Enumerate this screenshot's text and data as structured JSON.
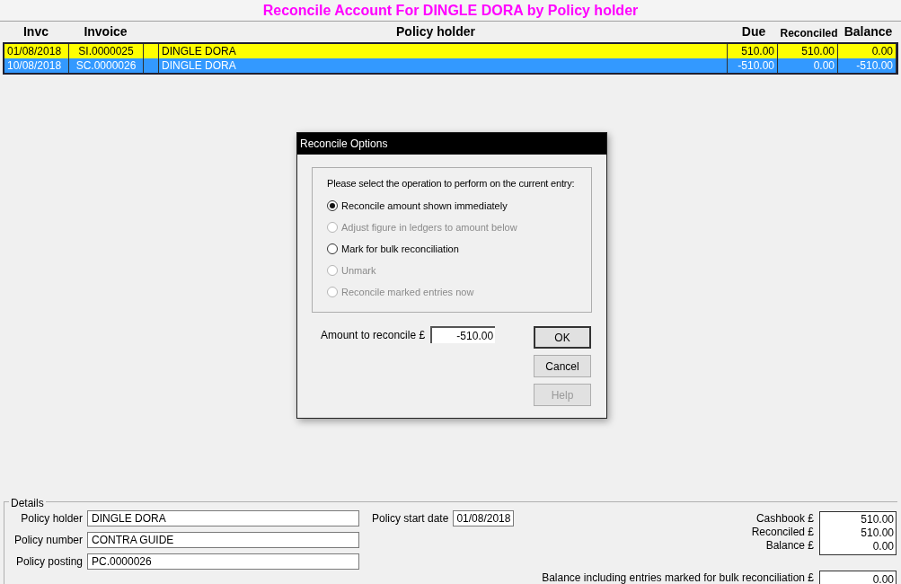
{
  "title": "Reconcile Account For DINGLE DORA by Policy holder",
  "table": {
    "columns": [
      "Invc",
      "Invoice",
      "Policy holder",
      "Due",
      "Reconciled",
      "Balance"
    ],
    "rows": [
      {
        "selected": false,
        "cells": [
          "01/08/2018",
          "SI.0000025",
          "DINGLE DORA",
          "510.00",
          "510.00",
          "0.00"
        ]
      },
      {
        "selected": true,
        "cells": [
          "10/08/2018",
          "SC.0000026",
          "DINGLE DORA",
          "-510.00",
          "0.00",
          "-510.00"
        ]
      }
    ]
  },
  "dialog": {
    "title": "Reconcile Options",
    "prompt": "Please select the operation to perform on the current entry:",
    "options": [
      {
        "label": "Reconcile amount shown immediately",
        "selected": true,
        "disabled": false
      },
      {
        "label": "Adjust figure in ledgers to amount below",
        "selected": false,
        "disabled": true
      },
      {
        "label": "Mark for bulk reconciliation",
        "selected": false,
        "disabled": false
      },
      {
        "label": "Unmark",
        "selected": false,
        "disabled": true
      },
      {
        "label": "Reconcile marked entries now",
        "selected": false,
        "disabled": true
      }
    ],
    "amount_label": "Amount to reconcile £",
    "amount_value": "-510.00",
    "buttons": [
      {
        "label": "OK",
        "disabled": false
      },
      {
        "label": "Cancel",
        "disabled": false
      },
      {
        "label": "Help",
        "disabled": true
      }
    ]
  },
  "details": {
    "title": "Details",
    "fields": [
      {
        "label": "Policy holder",
        "value": "DINGLE DORA"
      },
      {
        "label": "Policy number",
        "value": "CONTRA GUIDE"
      },
      {
        "label": "Policy posting",
        "value": "PC.0000026"
      }
    ],
    "start_date": {
      "label": "Policy start date",
      "value": "01/08/2018"
    },
    "totals": [
      {
        "label": "Cashbook £",
        "value": "510.00"
      },
      {
        "label": "Reconciled £",
        "value": "510.00"
      },
      {
        "label": "Balance £",
        "value": "0.00"
      }
    ],
    "bulk": {
      "label": "Balance including entries marked for bulk reconciliation £",
      "value": "0.00"
    }
  }
}
